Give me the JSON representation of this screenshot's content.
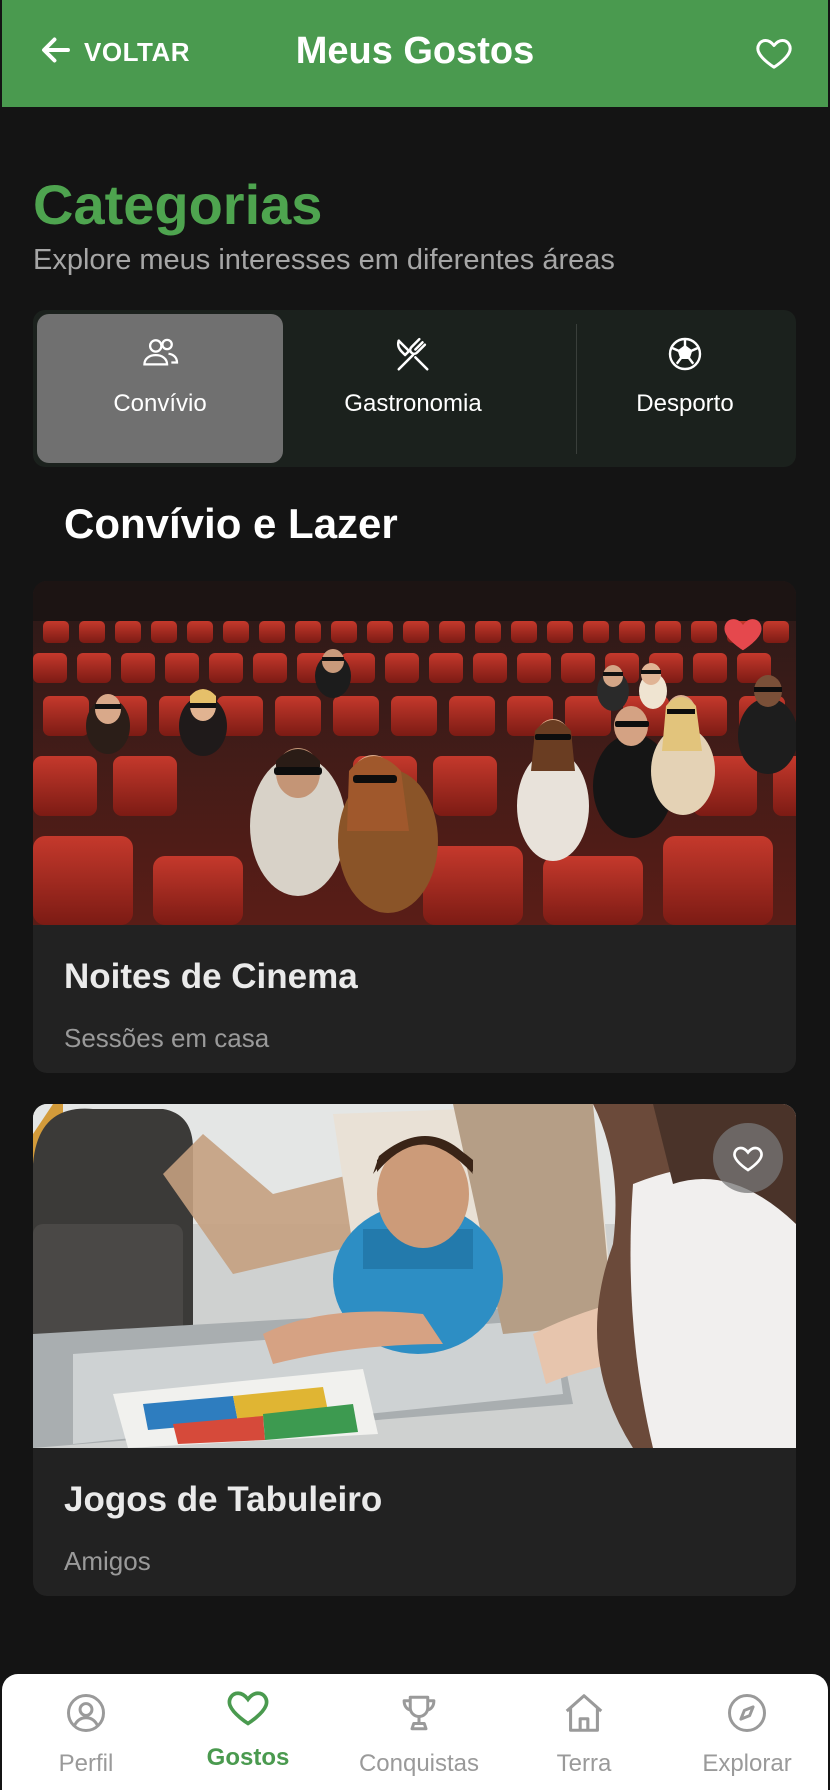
{
  "header": {
    "back_label": "VOLTAR",
    "title": "Meus Gostos"
  },
  "intro": {
    "title": "Categorias",
    "subtitle": "Explore meus interesses em diferentes áreas"
  },
  "tabs": [
    {
      "label": "Convívio",
      "icon": "people-icon",
      "active": true
    },
    {
      "label": "Gastronomia",
      "icon": "utensils-icon",
      "active": false
    },
    {
      "label": "Desporto",
      "icon": "soccer-ball-icon",
      "active": false
    }
  ],
  "category_title": "Convívio e Lazer",
  "cards": [
    {
      "title": "Noites de Cinema",
      "subtitle": "Sessões em casa",
      "favorited": true
    },
    {
      "title": "Jogos de Tabuleiro",
      "subtitle": "Amigos",
      "favorited": false
    }
  ],
  "bottom_nav": [
    {
      "label": "Perfil",
      "icon": "user-icon",
      "active": false
    },
    {
      "label": "Gostos",
      "icon": "heart-icon",
      "active": true
    },
    {
      "label": "Conquistas",
      "icon": "trophy-icon",
      "active": false
    },
    {
      "label": "Terra",
      "icon": "home-icon",
      "active": false
    },
    {
      "label": "Explorar",
      "icon": "compass-icon",
      "active": false
    }
  ],
  "colors": {
    "primary_green": "#4a9a4f",
    "background": "#141414",
    "favorite_red": "#e5484d"
  }
}
